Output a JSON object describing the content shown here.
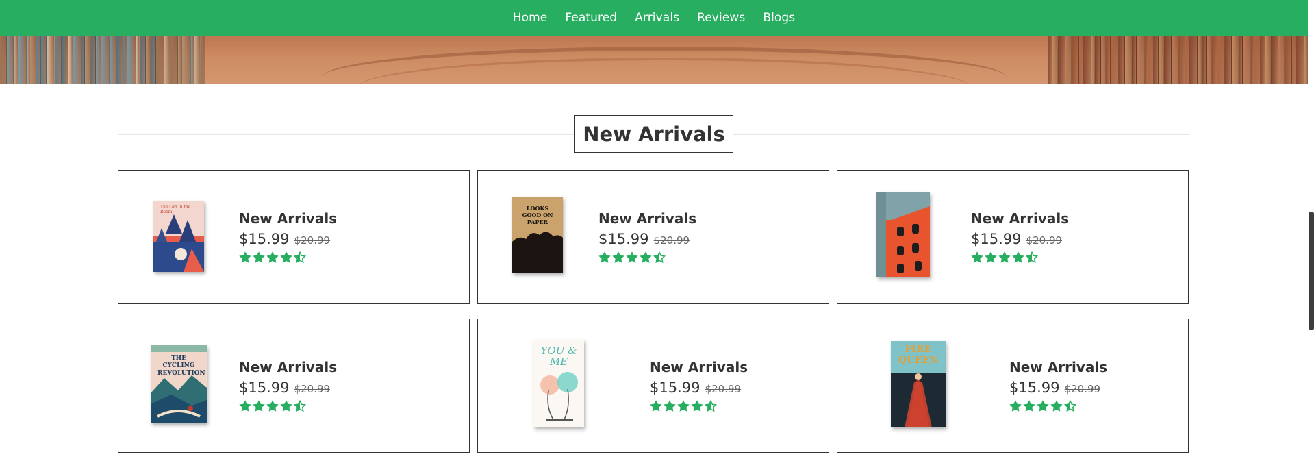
{
  "nav": {
    "items": [
      {
        "label": "Home"
      },
      {
        "label": "Featured"
      },
      {
        "label": "Arrivals"
      },
      {
        "label": "Reviews"
      },
      {
        "label": "Blogs"
      }
    ]
  },
  "section": {
    "title": "New Arrivals"
  },
  "products": [
    {
      "title": "New Arrivals",
      "price": "$15.99",
      "old_price": "$20.99",
      "rating": 4.5,
      "cover_title": "The Girl in the Room"
    },
    {
      "title": "New Arrivals",
      "price": "$15.99",
      "old_price": "$20.99",
      "rating": 4.5,
      "cover_title": "LOOKS GOOD ON PAPER"
    },
    {
      "title": "New Arrivals",
      "price": "$15.99",
      "old_price": "$20.99",
      "rating": 4.5,
      "cover_title": ""
    },
    {
      "title": "New Arrivals",
      "price": "$15.99",
      "old_price": "$20.99",
      "rating": 4.5,
      "cover_title": "THE CYCLING REVOLUTION"
    },
    {
      "title": "New Arrivals",
      "price": "$15.99",
      "old_price": "$20.99",
      "rating": 4.5,
      "cover_title": "YOU & ME"
    },
    {
      "title": "New Arrivals",
      "price": "$15.99",
      "old_price": "$20.99",
      "rating": 4.5,
      "cover_title": "FIRE QUEEN"
    }
  ],
  "colors": {
    "brand": "#27ae60",
    "text": "#333333",
    "star": "#27ae60"
  },
  "icons": {
    "rating": "star-icon",
    "rating_half": "star-half-icon"
  }
}
